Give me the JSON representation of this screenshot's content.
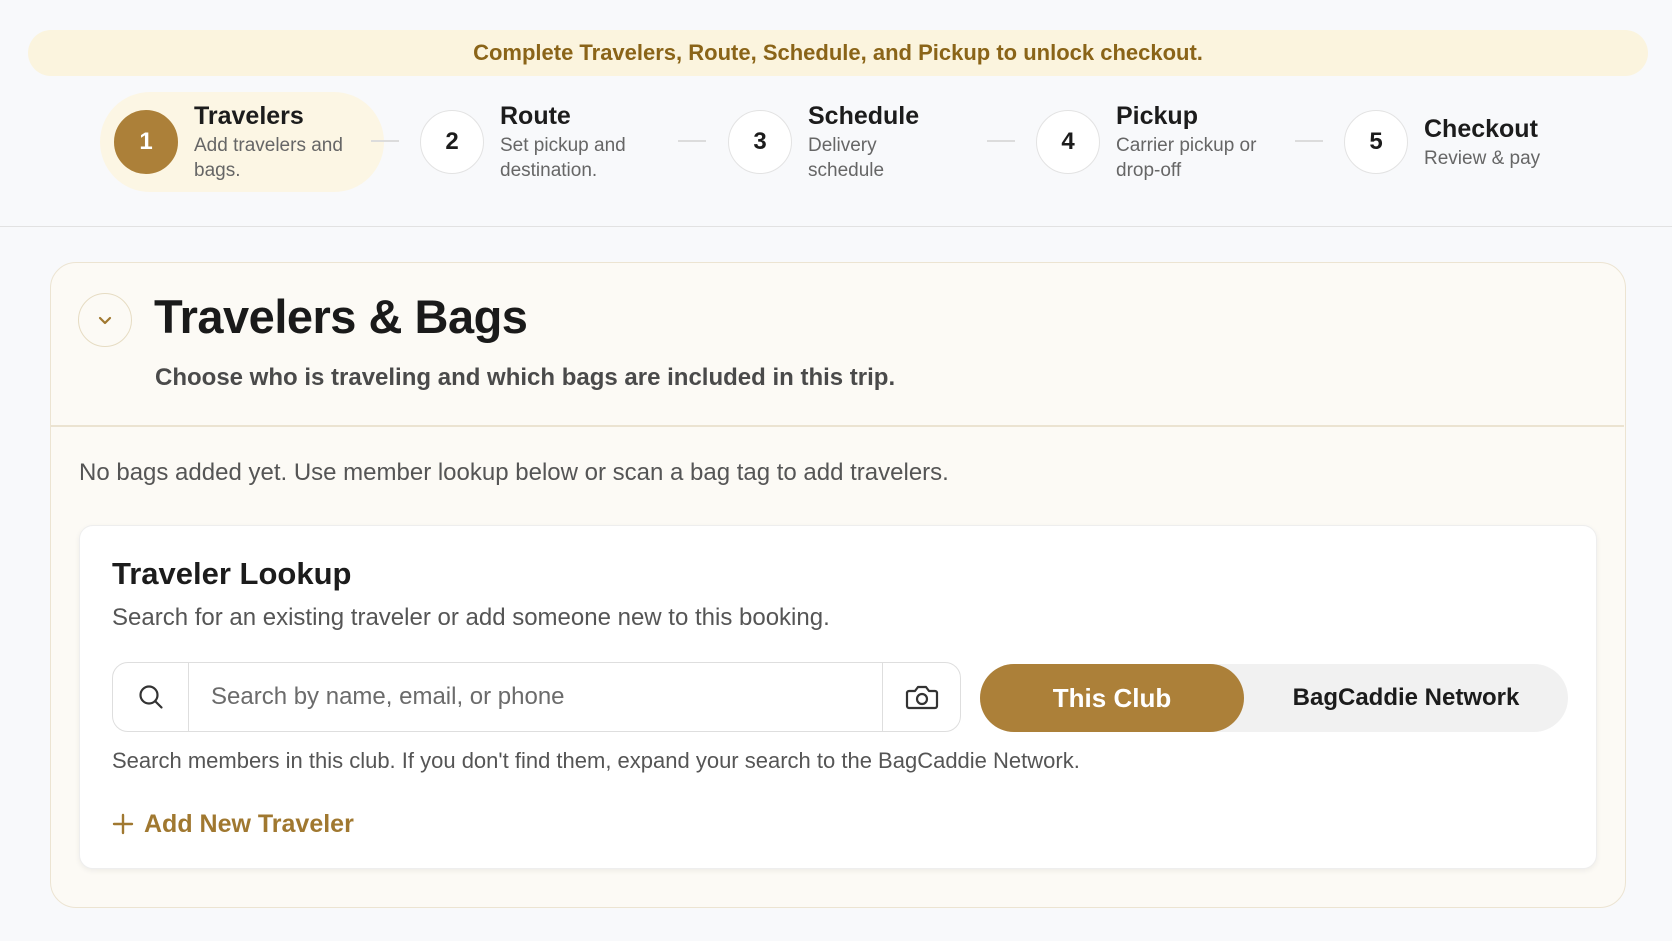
{
  "banner": {
    "text": "Complete Travelers, Route, Schedule, and Pickup to unlock checkout."
  },
  "steps": [
    {
      "number": "1",
      "title": "Travelers",
      "desc": "Add travelers and bags.",
      "active": true
    },
    {
      "number": "2",
      "title": "Route",
      "desc": "Set pickup and destination."
    },
    {
      "number": "3",
      "title": "Schedule",
      "desc": "Delivery schedule"
    },
    {
      "number": "4",
      "title": "Pickup",
      "desc": "Carrier pickup or drop-off"
    },
    {
      "number": "5",
      "title": "Checkout",
      "desc": "Review & pay"
    }
  ],
  "section": {
    "title": "Travelers & Bags",
    "subtitle": "Choose who is traveling and which bags are included in this trip.",
    "empty_message": "No bags added yet. Use member lookup below or scan a bag tag to add travelers."
  },
  "lookup": {
    "title": "Traveler Lookup",
    "subtitle": "Search for an existing traveler or add someone new to this booking.",
    "search_placeholder": "Search by name, email, or phone",
    "scope_options": [
      "This Club",
      "BagCaddie Network"
    ],
    "selected_scope": "This Club",
    "helper": "Search members in this club. If you don't find them, expand your search to the BagCaddie Network.",
    "add_label": "Add New Traveler"
  },
  "colors": {
    "accent": "#ac8039",
    "banner_bg": "#fbf4de",
    "banner_text": "#8a6418",
    "link": "#a07830"
  },
  "icons": {
    "collapse": "chevron-down-icon",
    "search": "search-icon",
    "camera": "camera-icon",
    "add": "plus-icon"
  }
}
